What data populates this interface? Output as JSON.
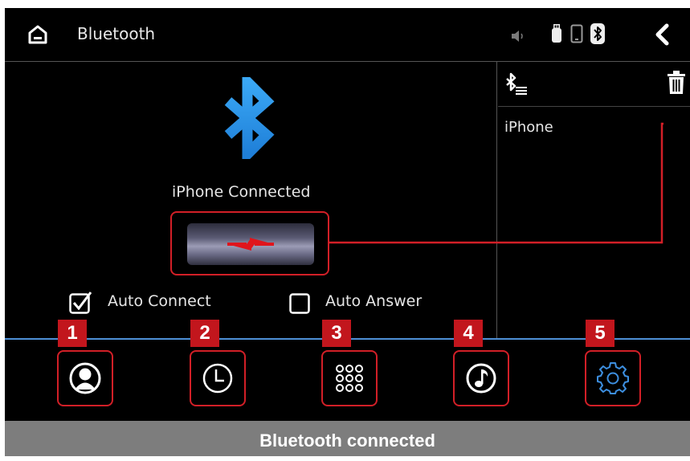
{
  "header": {
    "title": "Bluetooth",
    "home_icon": "home-icon",
    "status_icons": [
      "speaker-icon",
      "usb-icon",
      "phone-icon",
      "bluetooth-status-icon"
    ],
    "back_icon": "back-icon"
  },
  "connection": {
    "status_text": "iPhone Connected",
    "bluetooth_icon": "bluetooth-icon",
    "disconnect_icon": "disconnect-icon"
  },
  "device_panel": {
    "bt_list_icon": "bluetooth-list-icon",
    "delete_icon": "trash-icon",
    "devices": [
      "iPhone"
    ]
  },
  "options": {
    "auto_connect_label": "Auto Connect",
    "auto_connect_checked": true,
    "auto_answer_label": "Auto Answer",
    "auto_answer_checked": false
  },
  "nav": [
    {
      "badge": "1",
      "icon": "contacts-icon"
    },
    {
      "badge": "2",
      "icon": "call-history-icon"
    },
    {
      "badge": "3",
      "icon": "dialpad-icon"
    },
    {
      "badge": "4",
      "icon": "music-icon"
    },
    {
      "badge": "5",
      "icon": "settings-icon"
    }
  ],
  "caption": "Bluetooth connected",
  "colors": {
    "accent_red": "#d21f27",
    "badge_red": "#c2161d",
    "bluetooth_blue": "#2e9bf0",
    "divider_blue": "#4d8fd6",
    "caption_gray": "#7d7d7d"
  }
}
